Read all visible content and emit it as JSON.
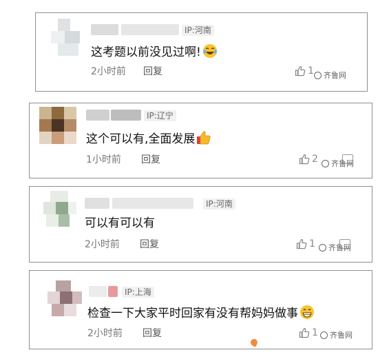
{
  "comments": [
    {
      "ip": "IP:河南",
      "content": "这考题以前没见过啊!",
      "emoji": "laughing-tears-emoji",
      "time": "2小时前",
      "reply": "回复",
      "likes": "1"
    },
    {
      "ip": "IP:辽宁",
      "content": "这个可以有,全面发展",
      "emoji": "thumbs-up-emoji",
      "time": "1小时前",
      "reply": "回复",
      "likes": "2"
    },
    {
      "ip": "IP:河南",
      "content": "可以有可以有",
      "emoji": "",
      "time": "2小时前",
      "reply": "回复",
      "likes": "1"
    },
    {
      "ip": "IP:上海",
      "content": "检查一下大家平时回家有没有帮妈妈做事",
      "emoji": "grinning-emoji",
      "time": "2小时前",
      "reply": "回复",
      "likes": "1"
    }
  ],
  "watermark": "齐鲁网",
  "colors": {
    "border": "#8e8e8e",
    "text": "#111111",
    "meta": "#777777",
    "ip_bg": "#f1f1f1"
  }
}
